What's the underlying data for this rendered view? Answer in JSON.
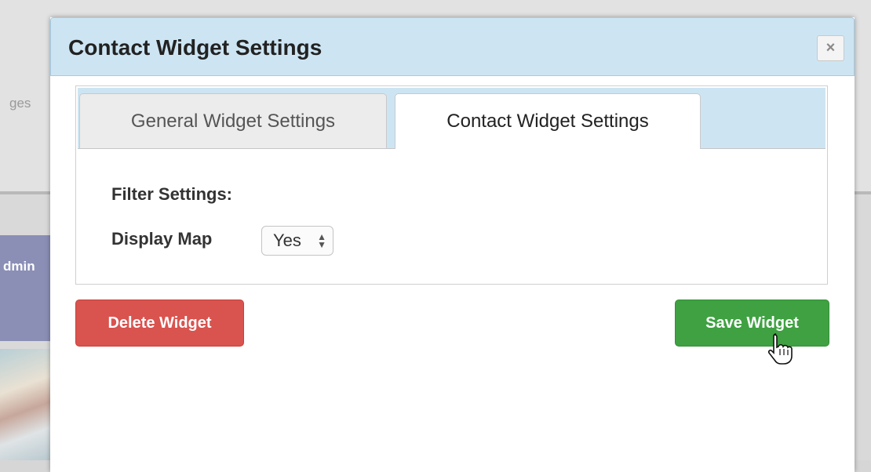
{
  "background": {
    "fragment_top": "ges",
    "fragment_side": "dmin"
  },
  "dialog": {
    "title": "Contact Widget Settings",
    "close_symbol": "×",
    "tabs": [
      {
        "label": "General Widget Settings",
        "active": false
      },
      {
        "label": "Contact Widget Settings",
        "active": true
      }
    ],
    "section_heading": "Filter Settings:",
    "display_map": {
      "label": "Display Map",
      "selected": "Yes"
    },
    "buttons": {
      "delete": "Delete Widget",
      "save": "Save Widget"
    }
  },
  "colors": {
    "header_bg": "#cde5f3",
    "delete": "#d9534f",
    "save": "#3fa142"
  }
}
